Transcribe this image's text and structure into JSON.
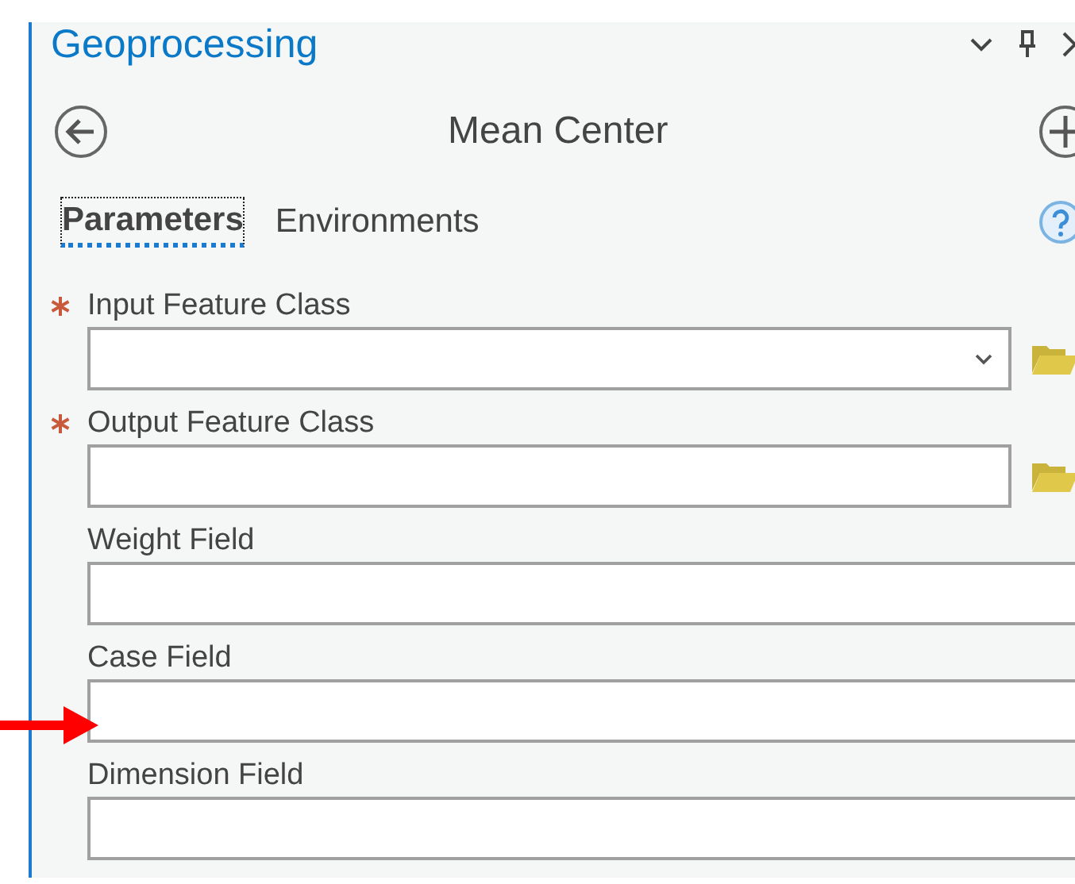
{
  "pane": {
    "title": "Geoprocessing"
  },
  "tool": {
    "title": "Mean Center"
  },
  "tabs": [
    {
      "label": "Parameters",
      "selected": true
    },
    {
      "label": "Environments",
      "selected": false
    }
  ],
  "parameters": [
    {
      "label": "Input Feature Class",
      "required": true,
      "dropdown": true,
      "browse": true
    },
    {
      "label": "Output Feature Class",
      "required": true,
      "dropdown": false,
      "browse": true
    },
    {
      "label": "Weight Field",
      "required": false,
      "dropdown": false,
      "browse": false
    },
    {
      "label": "Case Field",
      "required": false,
      "dropdown": false,
      "browse": false
    },
    {
      "label": "Dimension Field",
      "required": false,
      "dropdown": false,
      "browse": false
    }
  ]
}
